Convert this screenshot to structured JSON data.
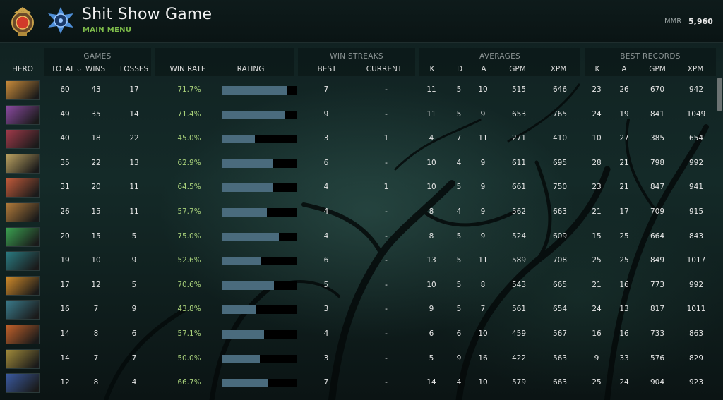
{
  "header": {
    "title": "Shit Show Game",
    "subtitle": "MAIN MENU",
    "mmr_label": "MMR",
    "mmr_value": "5,960"
  },
  "groups": {
    "games": "GAMES",
    "win_streaks": "WIN STREAKS",
    "averages": "AVERAGES",
    "best_records": "BEST RECORDS"
  },
  "columns": {
    "hero": "HERO",
    "total": "TOTAL",
    "wins": "WINS",
    "losses": "LOSSES",
    "win_rate": "WIN RATE",
    "rating": "RATING",
    "best": "BEST",
    "current": "CURRENT",
    "k": "K",
    "d": "D",
    "a": "A",
    "gpm": "GPM",
    "xpm": "XPM",
    "best_k": "K",
    "best_a": "A",
    "best_gpm": "GPM",
    "best_xpm": "XPM"
  },
  "rows": [
    {
      "hero_icon": "hero-1",
      "hero_color": "#c78a3a",
      "total": "60",
      "wins": "43",
      "losses": "17",
      "win_rate": "71.7%",
      "rating": 0.88,
      "best": "7",
      "current": "-",
      "k": "11",
      "d": "5",
      "a": "10",
      "gpm": "515",
      "xpm": "646",
      "bk": "23",
      "ba": "26",
      "bgpm": "670",
      "bxpm": "942"
    },
    {
      "hero_icon": "hero-2",
      "hero_color": "#8a4aa0",
      "total": "49",
      "wins": "35",
      "losses": "14",
      "win_rate": "71.4%",
      "rating": 0.84,
      "best": "9",
      "current": "-",
      "k": "11",
      "d": "5",
      "a": "9",
      "gpm": "653",
      "xpm": "765",
      "bk": "24",
      "ba": "19",
      "bgpm": "841",
      "bxpm": "1049"
    },
    {
      "hero_icon": "hero-3",
      "hero_color": "#a03a4a",
      "total": "40",
      "wins": "18",
      "losses": "22",
      "win_rate": "45.0%",
      "rating": 0.44,
      "best": "3",
      "current": "1",
      "k": "4",
      "d": "7",
      "a": "11",
      "gpm": "271",
      "xpm": "410",
      "bk": "10",
      "ba": "27",
      "bgpm": "385",
      "bxpm": "654"
    },
    {
      "hero_icon": "hero-4",
      "hero_color": "#b8a060",
      "total": "35",
      "wins": "22",
      "losses": "13",
      "win_rate": "62.9%",
      "rating": 0.68,
      "best": "6",
      "current": "-",
      "k": "10",
      "d": "4",
      "a": "9",
      "gpm": "611",
      "xpm": "695",
      "bk": "28",
      "ba": "21",
      "bgpm": "798",
      "bxpm": "992"
    },
    {
      "hero_icon": "hero-5",
      "hero_color": "#c05a3a",
      "total": "31",
      "wins": "20",
      "losses": "11",
      "win_rate": "64.5%",
      "rating": 0.69,
      "best": "4",
      "current": "1",
      "k": "10",
      "d": "5",
      "a": "9",
      "gpm": "661",
      "xpm": "750",
      "bk": "23",
      "ba": "21",
      "bgpm": "847",
      "bxpm": "941"
    },
    {
      "hero_icon": "hero-6",
      "hero_color": "#b07a3a",
      "total": "26",
      "wins": "15",
      "losses": "11",
      "win_rate": "57.7%",
      "rating": 0.6,
      "best": "4",
      "current": "-",
      "k": "8",
      "d": "4",
      "a": "9",
      "gpm": "562",
      "xpm": "663",
      "bk": "21",
      "ba": "17",
      "bgpm": "709",
      "bxpm": "915"
    },
    {
      "hero_icon": "hero-7",
      "hero_color": "#3aa050",
      "total": "20",
      "wins": "15",
      "losses": "5",
      "win_rate": "75.0%",
      "rating": 0.76,
      "best": "4",
      "current": "-",
      "k": "8",
      "d": "5",
      "a": "9",
      "gpm": "524",
      "xpm": "609",
      "bk": "15",
      "ba": "25",
      "bgpm": "664",
      "bxpm": "843"
    },
    {
      "hero_icon": "hero-8",
      "hero_color": "#2a7a80",
      "total": "19",
      "wins": "10",
      "losses": "9",
      "win_rate": "52.6%",
      "rating": 0.53,
      "best": "6",
      "current": "-",
      "k": "13",
      "d": "5",
      "a": "11",
      "gpm": "589",
      "xpm": "708",
      "bk": "25",
      "ba": "25",
      "bgpm": "849",
      "bxpm": "1017"
    },
    {
      "hero_icon": "hero-9",
      "hero_color": "#d08a2a",
      "total": "17",
      "wins": "12",
      "losses": "5",
      "win_rate": "70.6%",
      "rating": 0.7,
      "best": "5",
      "current": "-",
      "k": "10",
      "d": "5",
      "a": "8",
      "gpm": "543",
      "xpm": "665",
      "bk": "21",
      "ba": "16",
      "bgpm": "773",
      "bxpm": "992"
    },
    {
      "hero_icon": "hero-10",
      "hero_color": "#3a7a8a",
      "total": "16",
      "wins": "7",
      "losses": "9",
      "win_rate": "43.8%",
      "rating": 0.45,
      "best": "3",
      "current": "-",
      "k": "9",
      "d": "5",
      "a": "7",
      "gpm": "561",
      "xpm": "654",
      "bk": "24",
      "ba": "13",
      "bgpm": "817",
      "bxpm": "1011"
    },
    {
      "hero_icon": "hero-11",
      "hero_color": "#c0602a",
      "total": "14",
      "wins": "8",
      "losses": "6",
      "win_rate": "57.1%",
      "rating": 0.57,
      "best": "4",
      "current": "-",
      "k": "6",
      "d": "6",
      "a": "10",
      "gpm": "459",
      "xpm": "567",
      "bk": "16",
      "ba": "16",
      "bgpm": "733",
      "bxpm": "863"
    },
    {
      "hero_icon": "hero-12",
      "hero_color": "#a08a3a",
      "total": "14",
      "wins": "7",
      "losses": "7",
      "win_rate": "50.0%",
      "rating": 0.51,
      "best": "3",
      "current": "-",
      "k": "5",
      "d": "9",
      "a": "16",
      "gpm": "422",
      "xpm": "563",
      "bk": "9",
      "ba": "33",
      "bgpm": "576",
      "bxpm": "829"
    },
    {
      "hero_icon": "hero-13",
      "hero_color": "#3a5aa0",
      "total": "12",
      "wins": "8",
      "losses": "4",
      "win_rate": "66.7%",
      "rating": 0.62,
      "best": "7",
      "current": "-",
      "k": "14",
      "d": "4",
      "a": "10",
      "gpm": "579",
      "xpm": "663",
      "bk": "25",
      "ba": "24",
      "bgpm": "904",
      "bxpm": "923"
    }
  ]
}
